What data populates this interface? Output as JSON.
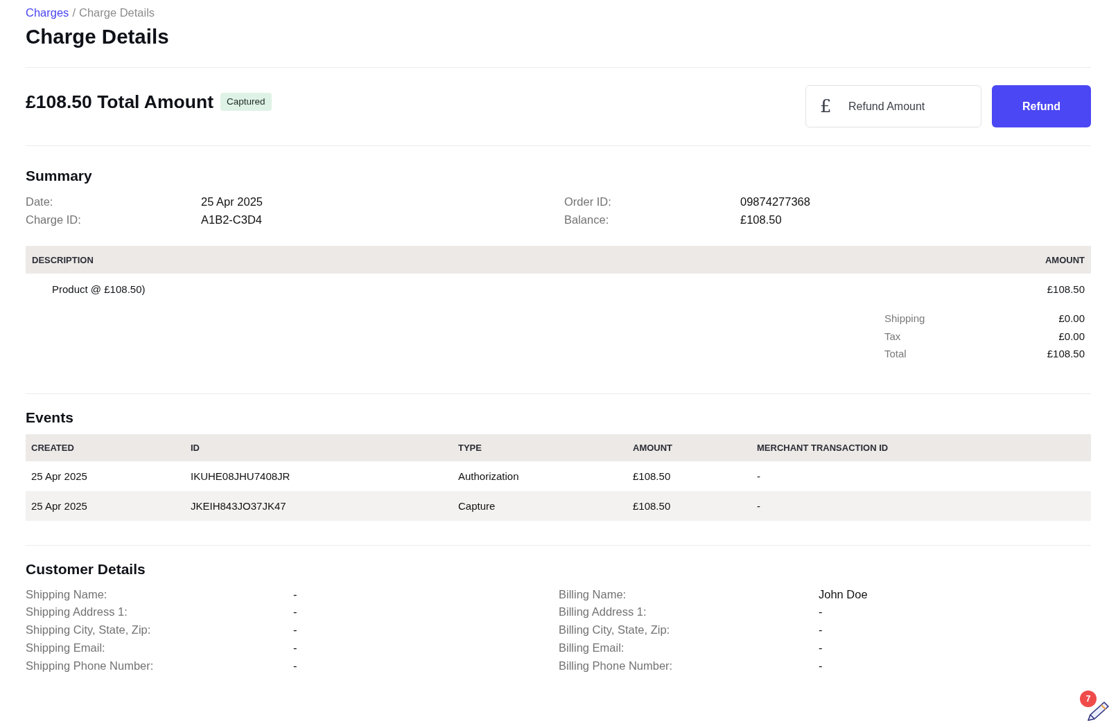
{
  "breadcrumb": {
    "separator": "/",
    "items": [
      {
        "label": "Charges",
        "kind": "link"
      },
      {
        "label": "Charge Details",
        "kind": "current"
      }
    ]
  },
  "page_title": "Charge Details",
  "charge_header": {
    "title": "£108.50 Total Amount",
    "status_badge": "Captured"
  },
  "refund": {
    "currency_symbol": "£",
    "placeholder": "Refund Amount",
    "button": "Refund"
  },
  "summary": {
    "title": "Summary",
    "columns": [
      [
        {
          "label": "Date:",
          "value": "25 Apr 2025"
        },
        {
          "label": "Charge ID:",
          "value": "A1B2-C3D4"
        }
      ],
      [
        {
          "label": "Order ID:",
          "value": "09874277368"
        },
        {
          "label": "Balance:",
          "value": "£108.50"
        }
      ]
    ]
  },
  "line_items": {
    "columns": [
      "DESCRIPTION",
      "AMOUNT"
    ],
    "rows": [
      {
        "description": "Product @ £108.50)",
        "amount": "£108.50"
      }
    ],
    "totals": [
      {
        "label": "Shipping",
        "value": "£0.00"
      },
      {
        "label": "Tax",
        "value": "£0.00"
      },
      {
        "label": "Total",
        "value": "£108.50"
      }
    ]
  },
  "events": {
    "title": "Events",
    "columns": [
      "CREATED",
      "ID",
      "TYPE",
      "AMOUNT",
      "MERCHANT TRANSACTION ID"
    ],
    "rows": [
      [
        "25 Apr 2025",
        "IKUHE08JHU7408JR",
        "Authorization",
        "£108.50",
        "-"
      ],
      [
        "25 Apr 2025",
        "JKEIH843JO37JK47",
        "Capture",
        "£108.50",
        "-"
      ]
    ]
  },
  "customer_details": {
    "title": "Customer Details",
    "columns": [
      [
        {
          "label": "Shipping Name:",
          "value": "-"
        },
        {
          "label": "Shipping Address 1:",
          "value": "-"
        },
        {
          "label": "Shipping City, State, Zip:",
          "value": "-"
        },
        {
          "label": "Shipping Email:",
          "value": "-"
        },
        {
          "label": "Shipping Phone Number:",
          "value": "-"
        }
      ],
      [
        {
          "label": "Billing Name:",
          "value": "John Doe"
        },
        {
          "label": "Billing Address 1:",
          "value": "-"
        },
        {
          "label": "Billing City, State, Zip:",
          "value": "-"
        },
        {
          "label": "Billing Email:",
          "value": "-"
        },
        {
          "label": "Billing Phone Number:",
          "value": "-"
        }
      ]
    ]
  },
  "floating_widget": {
    "badge_count": "7"
  }
}
